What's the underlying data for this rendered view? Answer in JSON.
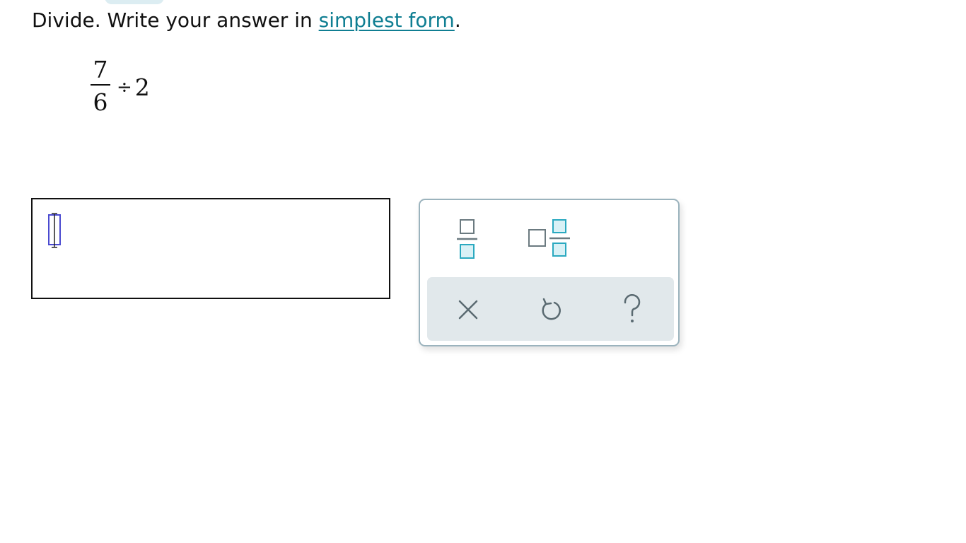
{
  "prompt": {
    "before": "Divide. Write your answer in ",
    "link": "simplest form",
    "after": "."
  },
  "problem": {
    "numerator": "7",
    "denominator": "6",
    "operator": "÷",
    "divisor": "2"
  },
  "answer": {
    "value": ""
  },
  "palette": {
    "buttons": [
      {
        "name": "fraction-template",
        "icon": "fraction-icon"
      },
      {
        "name": "mixed-number-template",
        "icon": "mixed-number-icon"
      }
    ],
    "actions": [
      {
        "name": "clear",
        "icon": "x-icon"
      },
      {
        "name": "undo",
        "icon": "undo-icon"
      },
      {
        "name": "help",
        "icon": "question-mark-icon"
      }
    ]
  },
  "colors": {
    "link": "#0f7e92",
    "teal": "#2aa9c0",
    "teal_fill": "#d8f1f6",
    "gray_icon": "#5a6a71",
    "palette_border": "#9bb3bd",
    "action_bg": "#e1e8eb",
    "cursor_blue": "#4a4ad0"
  }
}
